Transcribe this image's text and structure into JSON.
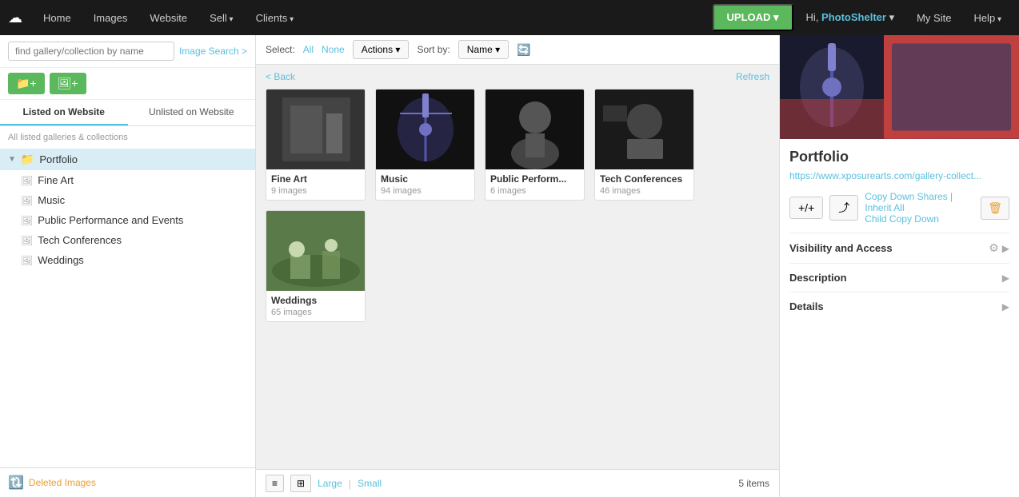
{
  "nav": {
    "logo": "☁",
    "items": [
      {
        "label": "Home",
        "arrow": false
      },
      {
        "label": "Images",
        "arrow": false
      },
      {
        "label": "Website",
        "arrow": false
      },
      {
        "label": "Sell",
        "arrow": true
      },
      {
        "label": "Clients",
        "arrow": true
      }
    ],
    "upload_label": "UPLOAD",
    "user_label": "Hi, ",
    "user_name": "PhotoShelter",
    "my_site": "My Site",
    "help": "Help"
  },
  "sidebar": {
    "search_placeholder": "find gallery/collection by name",
    "image_search_link": "Image Search >",
    "new_folder_icon": "📁",
    "new_image_icon": "🖼",
    "tabs": [
      {
        "label": "Listed on Website"
      },
      {
        "label": "Unlisted on Website"
      }
    ],
    "all_label": "All listed galleries & collections",
    "tree": [
      {
        "id": "portfolio",
        "label": "Portfolio",
        "icon": "folder",
        "level": 0,
        "selected": true
      },
      {
        "id": "fine-art",
        "label": "Fine Art",
        "icon": "image",
        "level": 1
      },
      {
        "id": "music",
        "label": "Music",
        "icon": "image",
        "level": 1
      },
      {
        "id": "public-perf",
        "label": "Public Performance and Events",
        "icon": "image",
        "level": 1
      },
      {
        "id": "tech-conf",
        "label": "Tech Conferences",
        "icon": "image",
        "level": 1
      },
      {
        "id": "weddings",
        "label": "Weddings",
        "icon": "image",
        "level": 1
      }
    ],
    "footer_label": "Deleted Images"
  },
  "toolbar": {
    "select_label": "Select:",
    "all_label": "All",
    "none_label": "None",
    "actions_label": "Actions",
    "sort_label": "Sort by:",
    "sort_value": "Name"
  },
  "gallery": {
    "back_label": "< Back",
    "refresh_label": "Refresh",
    "items": [
      {
        "id": "fine-art",
        "name": "Fine Art",
        "count": "9 images",
        "thumb_class": "thumb-fine-art"
      },
      {
        "id": "music",
        "name": "Music",
        "count": "94 images",
        "thumb_class": "thumb-music"
      },
      {
        "id": "public-perf",
        "name": "Public Perform...",
        "count": "6 images",
        "thumb_class": "thumb-public"
      },
      {
        "id": "tech-conf",
        "name": "Tech Conferences",
        "count": "46 images",
        "thumb_class": "thumb-tech"
      },
      {
        "id": "weddings",
        "name": "Weddings",
        "count": "65 images",
        "thumb_class": "thumb-weddings"
      }
    ],
    "footer": {
      "large_label": "Large",
      "small_label": "Small",
      "items_count": "5 items"
    }
  },
  "panel": {
    "title": "Portfolio",
    "url": "https://www.xposurearts.com/gallery-collect...",
    "copy_shares_label": "Copy Down Shares | Inherit All",
    "child_copy_label": "Child Copy Down",
    "sections": [
      {
        "label": "Visibility and Access",
        "has_gear": true
      },
      {
        "label": "Description",
        "has_gear": false
      },
      {
        "label": "Details",
        "has_gear": false
      }
    ]
  }
}
